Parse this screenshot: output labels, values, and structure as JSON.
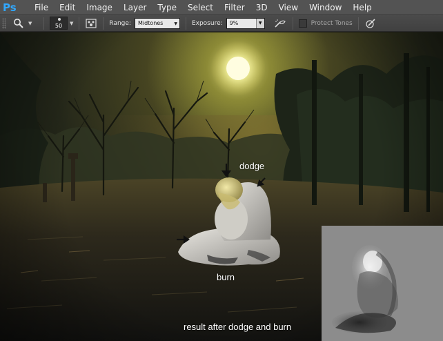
{
  "app": {
    "logo": "Ps"
  },
  "menu": {
    "items": [
      "File",
      "Edit",
      "Image",
      "Layer",
      "Type",
      "Select",
      "Filter",
      "3D",
      "View",
      "Window",
      "Help"
    ]
  },
  "options": {
    "tool_preset_icon": "dodge-tool-icon",
    "brush_size": "50",
    "range_label": "Range:",
    "range_value": "Midtones",
    "exposure_label": "Exposure:",
    "exposure_value": "9%",
    "protect_tones_label": "Protect Tones",
    "protect_tones_checked": false
  },
  "canvas": {
    "annotations": {
      "dodge": "dodge",
      "burn": "burn",
      "result": "result after dodge and burn"
    }
  },
  "colors": {
    "menubar": "#535353",
    "optbar": "#444444",
    "ps_blue": "#31a8ff",
    "sun": "#f5f3a0",
    "thumbnail_bg": "#8c8c8c"
  }
}
